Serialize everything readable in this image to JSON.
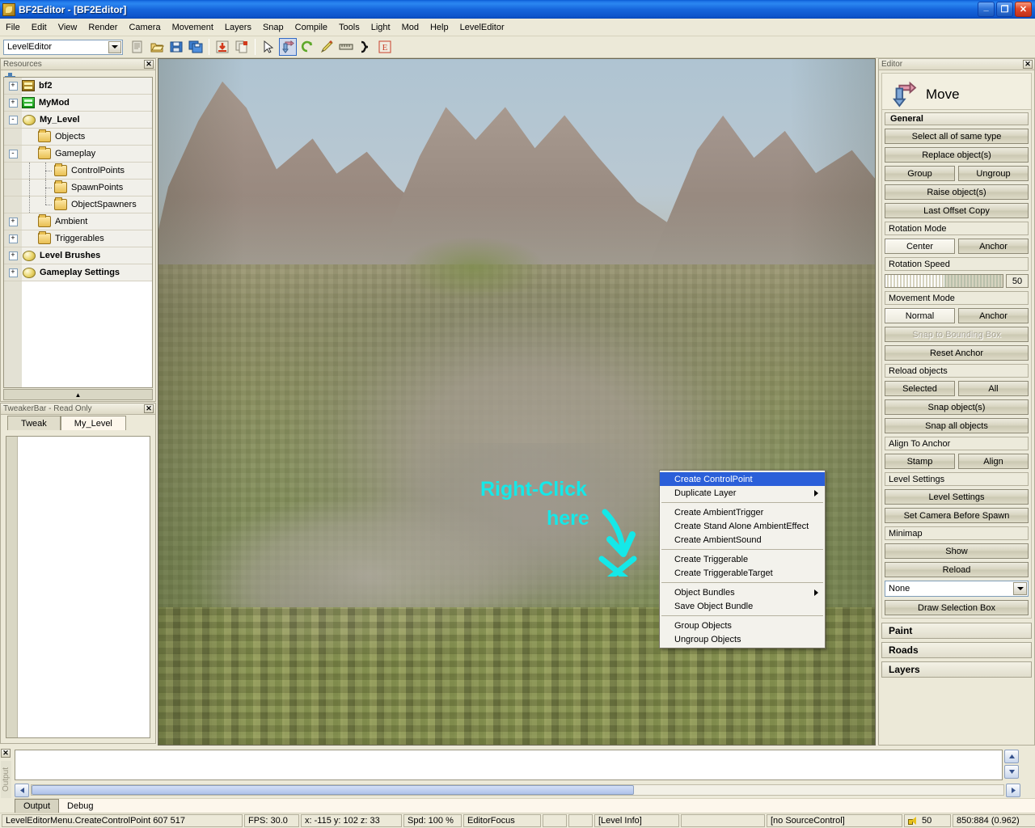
{
  "window": {
    "title": "BF2Editor  - [BF2Editor]",
    "icon": "bf2-app-icon",
    "buttons": {
      "minimize": "_",
      "restore": "❐",
      "close": "✕"
    }
  },
  "menubar": {
    "items": [
      "File",
      "Edit",
      "View",
      "Render",
      "Camera",
      "Movement",
      "Layers",
      "Snap",
      "Compile",
      "Tools",
      "Light",
      "Mod",
      "Help",
      "LevelEditor"
    ]
  },
  "toolbar": {
    "mode_value": "LevelEditor",
    "icons": [
      "new-file-icon",
      "open-folder-icon",
      "save-icon",
      "save-all-icon",
      "import-icon",
      "copy-paste-icon",
      "select-arrow-icon",
      "move-tool-icon",
      "rotate-tool-icon",
      "paint-brush-icon",
      "ruler-icon",
      "curve-icon",
      "editor-grid-icon"
    ]
  },
  "resources": {
    "title": "Resources",
    "close_label": "✕",
    "add_icon": "add-plus-icon",
    "tree": [
      {
        "expander": "+",
        "icon": "mod-icon",
        "label": "bf2",
        "bold": true,
        "indent": 0
      },
      {
        "expander": "+",
        "icon": "mod-icon-green",
        "label": "MyMod",
        "bold": true,
        "indent": 0
      },
      {
        "expander": "-",
        "icon": "sphere-icon",
        "label": "My_Level",
        "bold": true,
        "indent": 0
      },
      {
        "expander": "",
        "icon": "folder-icon",
        "label": "Objects",
        "bold": false,
        "indent": 1
      },
      {
        "expander": "-",
        "icon": "folder-icon",
        "label": "Gameplay",
        "bold": false,
        "indent": 1
      },
      {
        "expander": "",
        "icon": "folder-icon",
        "label": "ControlPoints",
        "bold": false,
        "indent": 2
      },
      {
        "expander": "",
        "icon": "folder-icon",
        "label": "SpawnPoints",
        "bold": false,
        "indent": 2
      },
      {
        "expander": "",
        "icon": "folder-icon",
        "label": "ObjectSpawners",
        "bold": false,
        "indent": 2
      },
      {
        "expander": "+",
        "icon": "folder-icon",
        "label": "Ambient",
        "bold": false,
        "indent": 1
      },
      {
        "expander": "+",
        "icon": "folder-icon",
        "label": "Triggerables",
        "bold": false,
        "indent": 1
      },
      {
        "expander": "+",
        "icon": "sphere-icon",
        "label": "Level Brushes",
        "bold": true,
        "indent": 0
      },
      {
        "expander": "+",
        "icon": "sphere-icon",
        "label": "Gameplay Settings",
        "bold": true,
        "indent": 0
      }
    ]
  },
  "tweaker": {
    "title": "TweakerBar - Read Only",
    "close_label": "✕",
    "tabs": [
      {
        "label": "Tweak",
        "selected": false
      },
      {
        "label": "My_Level",
        "selected": true
      }
    ]
  },
  "viewport": {
    "annotation": {
      "line1": "Right-Click",
      "line2": "here",
      "color": "#15e8e8",
      "arrow": "down-arrow-marker",
      "cross": "x-cross-marker"
    }
  },
  "context_menu": {
    "items": [
      {
        "label": "Create ControlPoint",
        "selected": true,
        "submenu": false,
        "sep_after": false
      },
      {
        "label": "Duplicate Layer",
        "selected": false,
        "submenu": true,
        "sep_after": true
      },
      {
        "label": "Create AmbientTrigger",
        "selected": false,
        "submenu": false,
        "sep_after": false
      },
      {
        "label": "Create Stand Alone AmbientEffect",
        "selected": false,
        "submenu": false,
        "sep_after": false
      },
      {
        "label": "Create AmbientSound",
        "selected": false,
        "submenu": false,
        "sep_after": true
      },
      {
        "label": "Create Triggerable",
        "selected": false,
        "submenu": false,
        "sep_after": false
      },
      {
        "label": "Create TriggerableTarget",
        "selected": false,
        "submenu": false,
        "sep_after": true
      },
      {
        "label": "Object Bundles",
        "selected": false,
        "submenu": true,
        "sep_after": false
      },
      {
        "label": "Save Object Bundle",
        "selected": false,
        "submenu": false,
        "sep_after": true
      },
      {
        "label": "Group Objects",
        "selected": false,
        "submenu": false,
        "sep_after": false
      },
      {
        "label": "Ungroup Objects",
        "selected": false,
        "submenu": false,
        "sep_after": false
      }
    ]
  },
  "editor": {
    "title": "Editor",
    "close_label": "✕",
    "tool_icon": "move-tool-icon",
    "tool_name": "Move",
    "general_header": "General",
    "buttons": {
      "select_all_same_type": "Select all of same type",
      "replace_objects": "Replace object(s)",
      "group": "Group",
      "ungroup": "Ungroup",
      "raise_objects": "Raise object(s)",
      "last_offset_copy": "Last Offset Copy",
      "rotation_mode_label": "Rotation Mode",
      "rotation_center": "Center",
      "rotation_anchor": "Anchor",
      "rotation_speed_label": "Rotation Speed",
      "rotation_speed_value": "50",
      "movement_mode_label": "Movement Mode",
      "movement_normal": "Normal",
      "movement_anchor": "Anchor",
      "snap_to_bounding_box": "Snap to Bounding Box",
      "reset_anchor": "Reset Anchor",
      "reload_objects_label": "Reload objects",
      "reload_selected": "Selected",
      "reload_all": "All",
      "snap_objects": "Snap object(s)",
      "snap_all_objects": "Snap all objects",
      "align_to_anchor_label": "Align To Anchor",
      "stamp": "Stamp",
      "align": "Align",
      "level_settings_label": "Level Settings",
      "level_settings": "Level Settings",
      "set_camera_before_spawn": "Set Camera Before Spawn",
      "minimap_label": "Minimap",
      "minimap_show": "Show",
      "minimap_reload": "Reload",
      "minimap_select_value": "None",
      "draw_selection_box": "Draw Selection Box"
    },
    "collapsed_sections": [
      "Paint",
      "Roads",
      "Layers"
    ]
  },
  "output": {
    "close_label": "✕",
    "side_label": "Output",
    "text": "",
    "tabs": [
      {
        "label": "Output",
        "selected": true
      },
      {
        "label": "Debug",
        "selected": false
      }
    ]
  },
  "statusbar": {
    "main": "LevelEditorMenu.CreateControlPoint 607 517",
    "fps": "FPS: 30.0",
    "coords": "x: -115 y: 102 z: 33",
    "speed": "Spd: 100 %",
    "focus": "EditorFocus",
    "empty1": "",
    "empty2": "",
    "level_info": "[Level Info]",
    "empty3": "",
    "source_control": "[no SourceControl]",
    "volume_icon": "speaker-icon",
    "volume": "50",
    "resolution": "850:884 (0.962)"
  }
}
